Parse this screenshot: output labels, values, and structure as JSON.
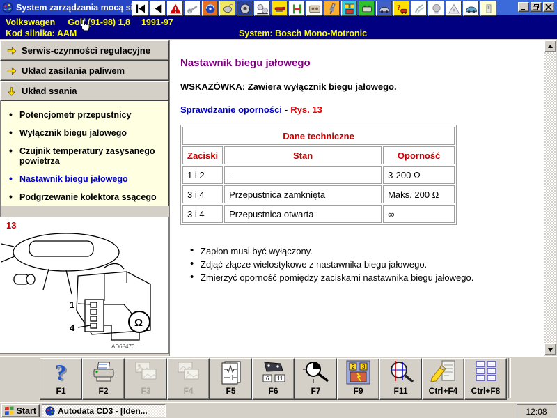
{
  "window": {
    "title": "System zarządzania mocą siln"
  },
  "toolbar_icons": [
    {
      "name": "nav-first",
      "bg": "#ffffff"
    },
    {
      "name": "nav-back",
      "bg": "#ffffff"
    },
    {
      "name": "warning",
      "bg": "#ffffff"
    },
    {
      "name": "wrench-tools",
      "bg": "#ffffff"
    },
    {
      "name": "globe-gauge",
      "bg": "#e87020"
    },
    {
      "name": "mouse",
      "bg": "#f0e860"
    },
    {
      "name": "wheel",
      "bg": "#2840a0"
    },
    {
      "name": "pulleys",
      "bg": "#ffffff"
    },
    {
      "name": "red-tool",
      "bg": "#ffe000"
    },
    {
      "name": "lift",
      "bg": "#ffffff"
    },
    {
      "name": "dashboard",
      "bg": "#ffffff"
    },
    {
      "name": "spark-plug",
      "bg": "#ffb030"
    },
    {
      "name": "component-location",
      "bg": "#38c8e0"
    },
    {
      "name": "ecu-box",
      "bg": "#30c030"
    },
    {
      "name": "car-tools",
      "bg": "#4060c8"
    },
    {
      "name": "help-vehicle",
      "bg": "#ffe000"
    },
    {
      "name": "exhaust-arrows",
      "bg": "#ffffff"
    },
    {
      "name": "ball-part",
      "bg": "#ffffff"
    },
    {
      "name": "triangle-part",
      "bg": "#ffffff"
    },
    {
      "name": "car-sketch",
      "bg": "#ffffff"
    },
    {
      "name": "switch-panel",
      "bg": "#ffffd0"
    }
  ],
  "vehicle_header": {
    "make": "Volkswagen",
    "model": "Golf (91-98) 1,8",
    "years": "1991-97",
    "engine_code": "Kod silnika: AAM",
    "system": "System: Bosch Mono-Motronic"
  },
  "sidebar": {
    "sections": [
      {
        "label": "Serwis-czynności regulacyjne",
        "expanded": false
      },
      {
        "label": "Układ zasilania paliwem",
        "expanded": false
      },
      {
        "label": "Układ ssania",
        "expanded": true,
        "items": [
          {
            "label": "Potencjometr przepustnicy",
            "active": false
          },
          {
            "label": "Wyłącznik biegu jałowego",
            "active": false
          },
          {
            "label": "Czujnik temperatury zasysanego powietrza",
            "active": false
          },
          {
            "label": "Nastawnik biegu jałowego",
            "active": true
          },
          {
            "label": "Podgrzewanie kolektora ssącego",
            "active": false
          }
        ]
      }
    ]
  },
  "figure": {
    "number": "13",
    "pin_top": "1",
    "pin_bottom": "4",
    "meter_symbol": "Ω",
    "drawing_code": "AD68470"
  },
  "content": {
    "title": "Nastawnik biegu jałowego",
    "note": "WSKAZÓWKA: Zawiera wyłącznik biegu jałowego.",
    "subheading": "Sprawdzanie oporności",
    "subheading_dash": "-",
    "figure_ref": "Rys. 13",
    "table": {
      "title": "Dane techniczne",
      "columns": [
        "Zaciski",
        "Stan",
        "Oporność"
      ],
      "rows": [
        [
          "1 i 2",
          "-",
          "3-200 Ω"
        ],
        [
          "3 i 4",
          "Przepustnica zamknięta",
          "Maks. 200 Ω"
        ],
        [
          "3 i 4",
          "Przepustnica otwarta",
          "∞"
        ]
      ]
    },
    "bullets": [
      "Zapłon musi być wyłączony.",
      "Zdjąć złącze wielostykowe z nastawnika biegu jałowego.",
      "Zmierzyć oporność pomiędzy zaciskami nastawnika biegu jałowego."
    ]
  },
  "fkeys": [
    {
      "label": "F1",
      "icon": "help",
      "enabled": true
    },
    {
      "label": "F2",
      "icon": "print",
      "enabled": true
    },
    {
      "label": "F3",
      "icon": "image-prev",
      "enabled": false
    },
    {
      "label": "F4",
      "icon": "image-next",
      "enabled": false
    },
    {
      "label": "F5",
      "icon": "wiring-diagram",
      "enabled": true
    },
    {
      "label": "F6",
      "icon": "connector-pins",
      "enabled": true
    },
    {
      "label": "F7",
      "icon": "adjustment-magnifier",
      "enabled": true
    },
    {
      "label": "F9",
      "icon": "component-location",
      "enabled": true
    },
    {
      "label": "F11",
      "icon": "locate-magnifier",
      "enabled": true
    },
    {
      "label": "Ctrl+F4",
      "icon": "notes-pencil",
      "enabled": true
    },
    {
      "label": "Ctrl+F8",
      "icon": "menu-list",
      "enabled": true
    }
  ],
  "taskbar": {
    "start_label": "Start",
    "task_label": "Autodata CD3 - [Iden...",
    "clock": "12:08"
  },
  "colors": {
    "header_bg": "#000080",
    "header_text": "#ffff00",
    "title_purple": "#800080",
    "link_blue": "#0000cc",
    "accent_red": "#cc0000",
    "sidebar_bg": "#ffffe1",
    "ui_gray": "#d4d0c8"
  }
}
